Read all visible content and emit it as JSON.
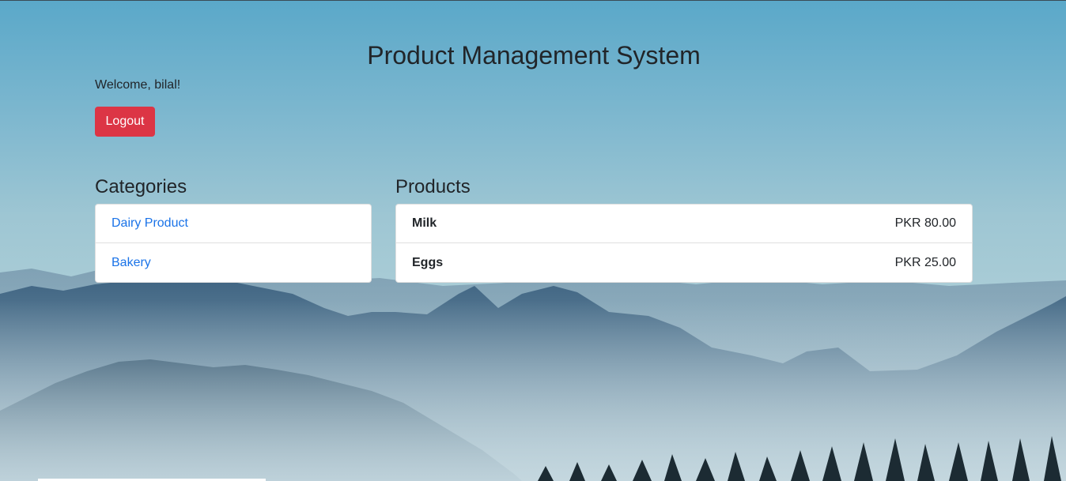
{
  "header": {
    "title": "Product Management System",
    "welcome": "Welcome, bilal!",
    "logout_label": "Logout"
  },
  "categories": {
    "heading": "Categories",
    "items": [
      {
        "label": "Dairy Product"
      },
      {
        "label": "Bakery"
      }
    ]
  },
  "products": {
    "heading": "Products",
    "items": [
      {
        "name": "Milk",
        "price": "PKR 80.00"
      },
      {
        "name": "Eggs",
        "price": "PKR 25.00"
      }
    ]
  },
  "colors": {
    "logout_button": "#dc3545",
    "link": "#1a73e8",
    "text": "#212529"
  }
}
